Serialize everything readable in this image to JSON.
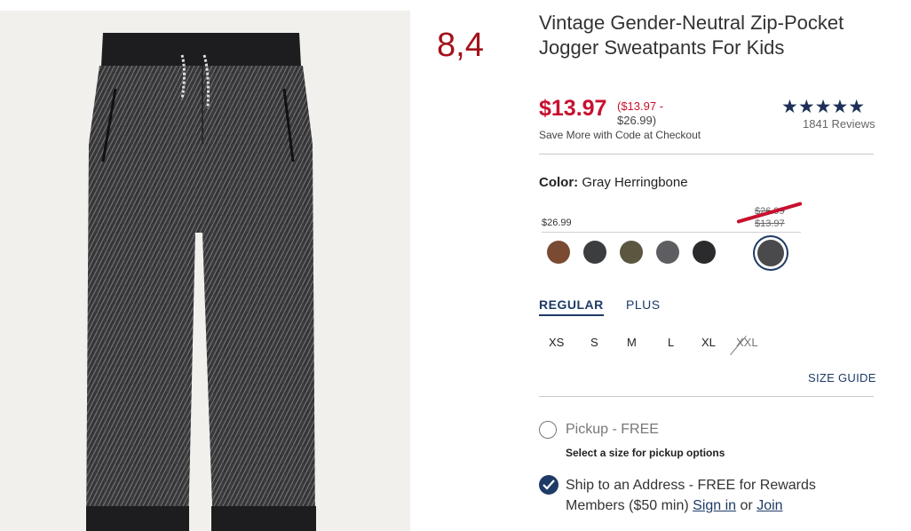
{
  "annotation": "8,4",
  "product": {
    "title": "Vintage Gender-Neutral Zip-Pocket Jogger Sweatpants For Kids",
    "sale_price": "$13.97",
    "range_low": "($13.97 -",
    "range_high": "$26.99)",
    "promo": "Save More with Code at Checkout",
    "rating_stars": "★★★★★",
    "reviews": "1841 Reviews"
  },
  "color": {
    "label": "Color:",
    "value": "Gray Herringbone",
    "regular_price": "$26.99",
    "strike_price_1": "$26.99",
    "strike_price_2": "$13.97",
    "swatches": [
      {
        "name": "brown",
        "color": "#7a4a33"
      },
      {
        "name": "charcoal",
        "color": "#3b3d3f"
      },
      {
        "name": "camo",
        "color": "#5b5640"
      },
      {
        "name": "gray",
        "color": "#5e5e62"
      },
      {
        "name": "black",
        "color": "#2b2b2d"
      },
      {
        "name": "gray-herringbone",
        "color": "#4a4a4c"
      }
    ]
  },
  "fit_tabs": [
    "REGULAR",
    "PLUS"
  ],
  "sizes": [
    "XS",
    "S",
    "M",
    "L",
    "XL",
    "XXL"
  ],
  "size_guide": "SIZE GUIDE",
  "fulfillment": {
    "pickup_label": "Pickup - FREE",
    "pickup_hint": "Select a size for pickup options",
    "ship_label": "Ship to an Address - FREE for Rewards Members ($50 min)",
    "sign_in": "Sign in",
    "or": "or",
    "join": "Join"
  },
  "colors": {
    "sale_red": "#c8102e",
    "navy": "#1e3a66",
    "annotation_red": "#a3121a"
  }
}
